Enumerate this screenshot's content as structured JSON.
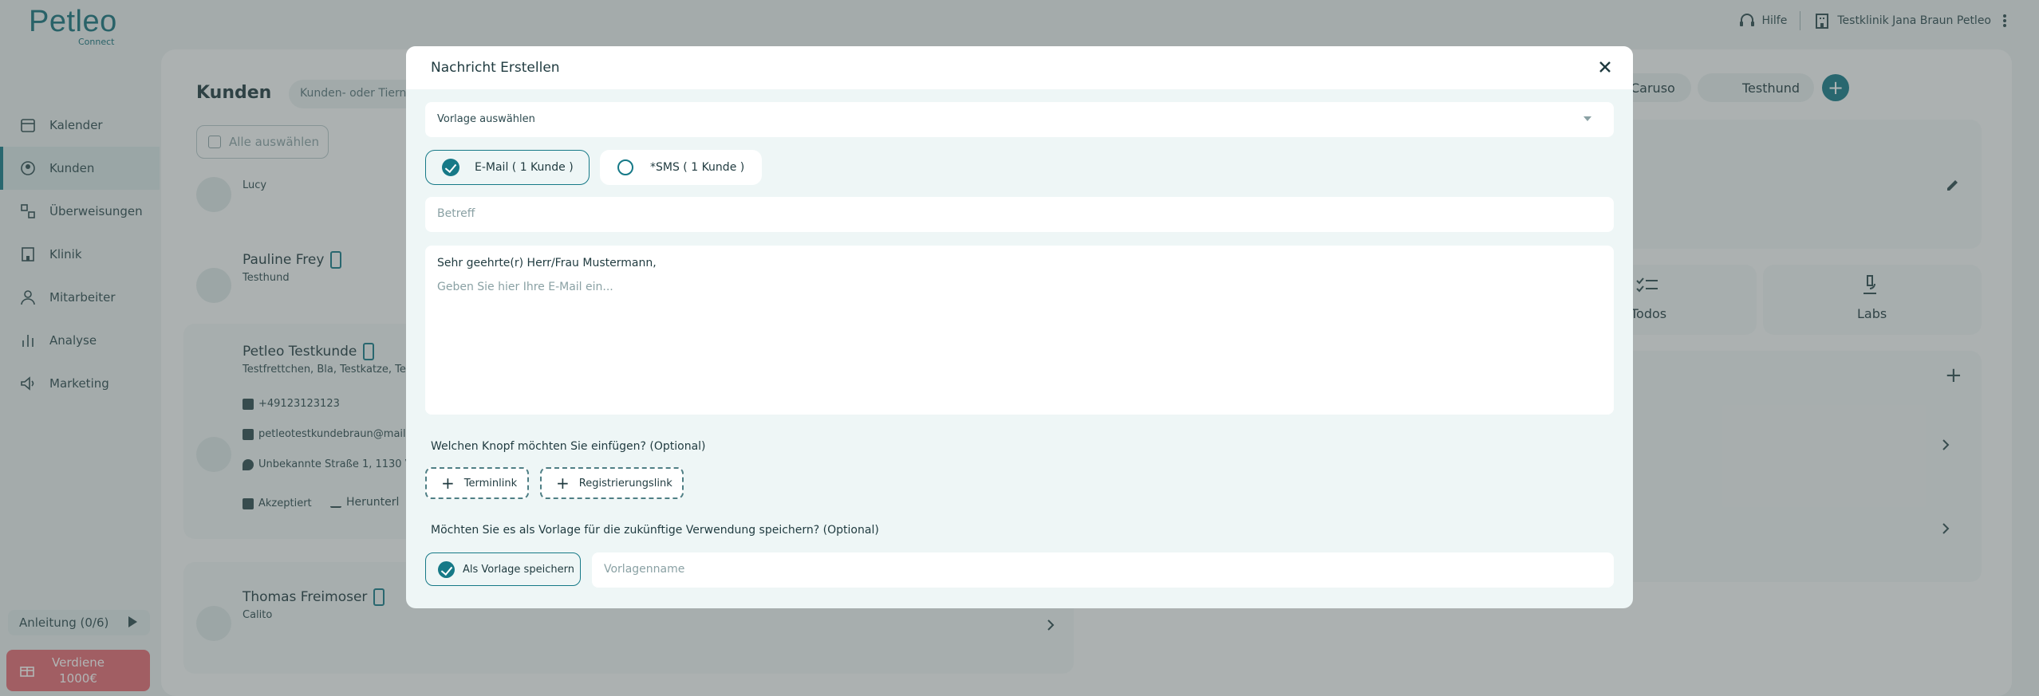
{
  "brand": {
    "name": "Petleo",
    "sub": "Connect"
  },
  "topbar": {
    "help": "Hilfe",
    "clinic": "Testklinik Jana Braun Petleo"
  },
  "sidebar": {
    "items": [
      {
        "label": "Kalender",
        "icon": "calendar-icon"
      },
      {
        "label": "Kunden",
        "icon": "customers-icon"
      },
      {
        "label": "Überweisungen",
        "icon": "referrals-icon"
      },
      {
        "label": "Klinik",
        "icon": "clinic-icon"
      },
      {
        "label": "Mitarbeiter",
        "icon": "staff-icon"
      },
      {
        "label": "Analyse",
        "icon": "analytics-icon"
      },
      {
        "label": "Marketing",
        "icon": "marketing-icon"
      }
    ],
    "guide": "Anleitung (0/6)",
    "earn_line1": "Verdiene",
    "earn_line2": "1000€"
  },
  "main": {
    "title": "Kunden",
    "search_placeholder": "Kunden- oder Tiern",
    "select_all": "Alle auswählen",
    "customers": [
      {
        "name": "",
        "pets": "Lucy"
      },
      {
        "name": "Pauline Frey",
        "pets": "Testhund"
      },
      {
        "name": "Petleo Testkunde",
        "pets": "Testfrettchen, Bla, Testkatze, Test",
        "phone": "+49123123123",
        "email": "petleotestkundebraun@mail",
        "address": "Unbekannte Straße 1, 1130 Vie",
        "consent": "Akzeptiert",
        "download": "Herunterl"
      },
      {
        "name": "Thomas Freimoser",
        "pets": "Calito"
      }
    ],
    "chips": [
      "Caruso",
      "Testhund"
    ],
    "tiles": [
      "Todos",
      "Labs"
    ]
  },
  "modal": {
    "title": "Nachricht Erstellen",
    "template_select": "Vorlage auswählen",
    "channel_email": "E-Mail ( 1 Kunde )",
    "channel_sms": "*SMS ( 1 Kunde )",
    "subject_placeholder": "Betreff",
    "greeting": "Sehr geehrte(r) Herr/Frau Mustermann,",
    "body_placeholder": "Geben Sie hier Ihre E-Mail ein...",
    "button_question": "Welchen Knopf möchten Sie einfügen? (Optional)",
    "button_termin": "Terminlink",
    "button_registrierung": "Registrierungslink",
    "save_question": "Möchten Sie es als Vorlage für die zukünftige Verwendung speichern? (Optional)",
    "save_checkbox": "Als Vorlage speichern",
    "template_name_placeholder": "Vorlagenname"
  },
  "colors": {
    "accent": "#167987",
    "earn": "#e46a73"
  }
}
